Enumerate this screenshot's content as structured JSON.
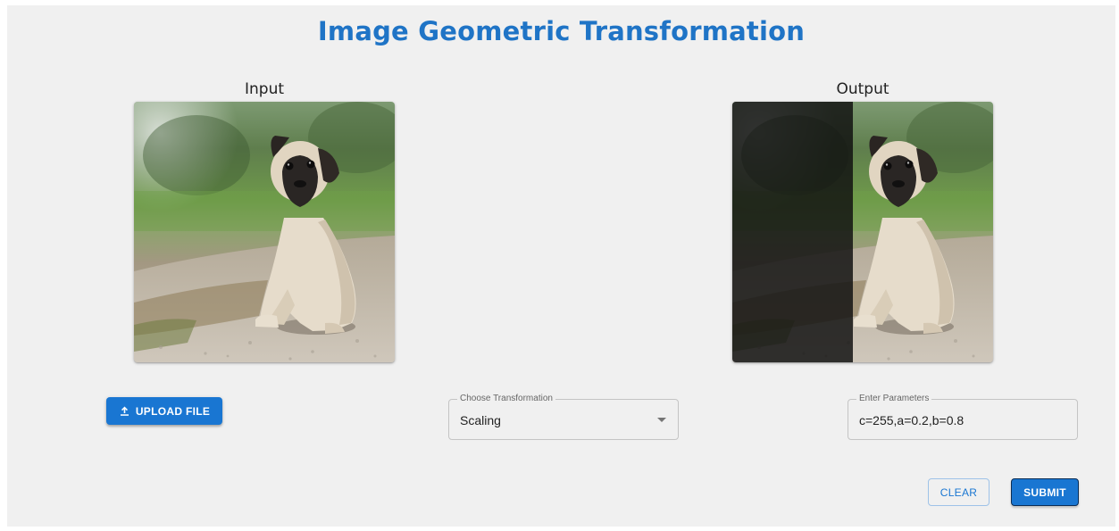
{
  "header": {
    "title": "Image Geometric Transformation"
  },
  "input_panel": {
    "label": "Input",
    "image_subject": "pug puppy sitting on gravel path"
  },
  "output_panel": {
    "label": "Output",
    "image_subject": "pug puppy sitting on gravel path, left portion darkened"
  },
  "upload": {
    "label": "UPLOAD FILE",
    "icon": "upload-icon"
  },
  "transformation_select": {
    "legend": "Choose Transformation",
    "selected": "Scaling",
    "icon": "arrow-drop-down-icon"
  },
  "parameters_field": {
    "legend": "Enter Parameters",
    "value": "c=255,a=0.2,b=0.8"
  },
  "actions": {
    "clear_label": "CLEAR",
    "submit_label": "SUBMIT"
  },
  "colors": {
    "primary": "#1976d2",
    "title": "#1f74c6",
    "background": "#f0f0f0"
  }
}
